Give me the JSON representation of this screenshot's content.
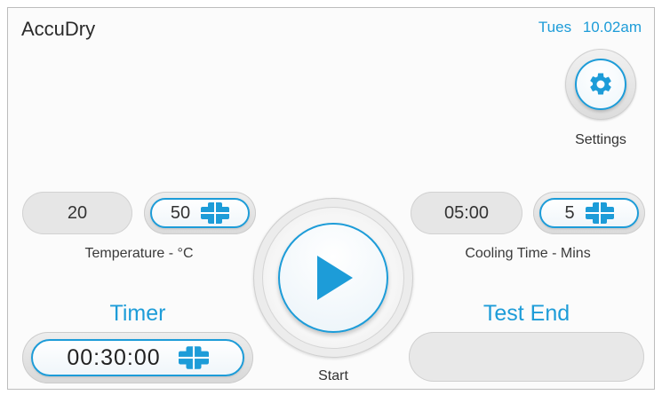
{
  "header": {
    "app_title": "AccuDry",
    "day": "Tues",
    "time": "10.02am"
  },
  "settings": {
    "label": "Settings",
    "icon": "gear-icon"
  },
  "temperature": {
    "current": "20",
    "setpoint": "50",
    "caption": "Temperature - °C"
  },
  "cooling": {
    "current": "05:00",
    "setpoint": "5",
    "caption": "Cooling Time - Mins"
  },
  "timer": {
    "title": "Timer",
    "value": "00:30:00"
  },
  "test_end": {
    "title": "Test End",
    "value": ""
  },
  "start": {
    "label": "Start",
    "icon": "play-icon"
  },
  "colors": {
    "accent": "#1d9cd8",
    "text": "#333333",
    "panel": "#e6e6e6"
  }
}
